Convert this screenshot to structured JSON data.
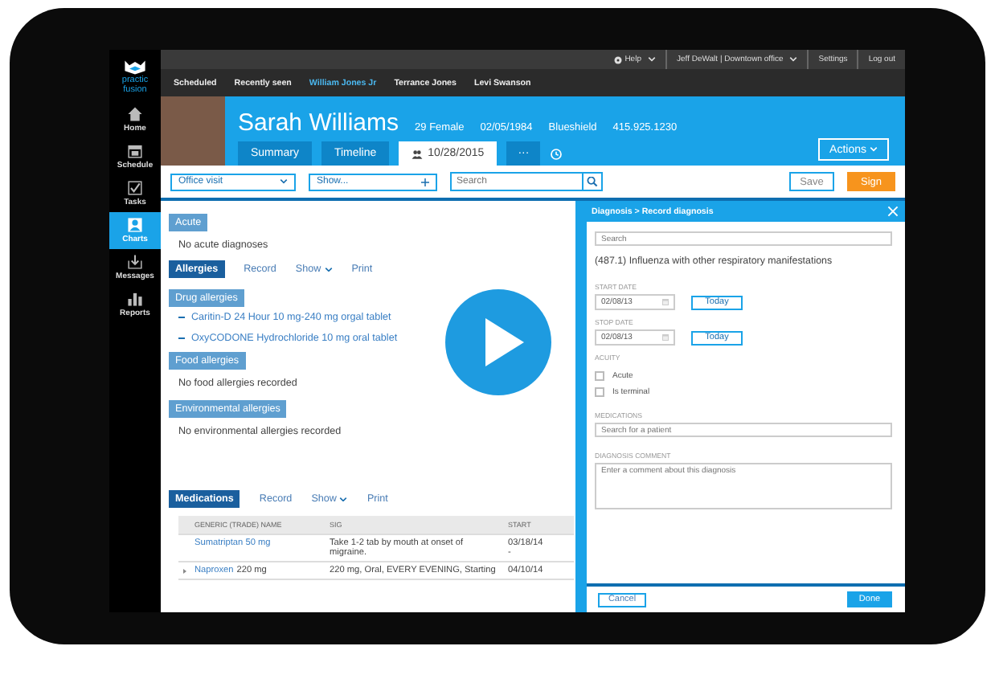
{
  "sidebar": {
    "logo": [
      "practic",
      "fusion"
    ],
    "items": [
      {
        "label": "Home",
        "selected": false
      },
      {
        "label": "Schedule",
        "selected": false
      },
      {
        "label": "Tasks",
        "selected": false
      },
      {
        "label": "Charts",
        "selected": true
      },
      {
        "label": "Messages",
        "selected": false
      },
      {
        "label": "Reports",
        "selected": false
      }
    ]
  },
  "top_bar": {
    "help": "Help",
    "user": "Jeff DeWalt | Downtown office",
    "links": [
      "Settings",
      "Log out"
    ]
  },
  "recent_bar": {
    "items": [
      {
        "label": "Scheduled",
        "selected": false
      },
      {
        "label": "Recently seen",
        "selected": false
      },
      {
        "label": "William Jones Jr",
        "selected": true
      },
      {
        "label": "Terrance Jones",
        "selected": false
      },
      {
        "label": "Levi Swanson",
        "selected": false
      }
    ]
  },
  "patient": {
    "name": "Sarah Williams",
    "details": [
      "29 Female",
      "02/05/1984",
      "Blueshield",
      "415.925.1230"
    ],
    "tabs": [
      {
        "label": "Summary",
        "kind": "text",
        "selected": false
      },
      {
        "label": "Timeline",
        "kind": "text",
        "selected": false
      },
      {
        "label": "10/28/2015",
        "kind": "encounter",
        "selected": true
      }
    ],
    "more": "···",
    "actions": "Actions"
  },
  "toolbar": {
    "visit_type": "Office visit",
    "show": "Show...",
    "search_placeholder": "Search",
    "save": "Save",
    "sign": "Sign"
  },
  "acute": {
    "heading": "Acute",
    "text": "No acute diagnoses"
  },
  "allergies": {
    "tab": "Allergies",
    "actions": [
      {
        "label": "Record",
        "dropdown": false
      },
      {
        "label": "Show",
        "dropdown": true
      },
      {
        "label": "Print",
        "dropdown": false
      }
    ],
    "groups": [
      {
        "heading": "Drug allergies",
        "items": [
          "Caritin-D 24 Hour 10 mg-240 mg orgal tablet",
          "OxyCODONE Hydrochloride 10 mg oral tablet"
        ]
      },
      {
        "heading": "Food allergies",
        "empty": "No food allergies recorded"
      },
      {
        "heading": "Environmental allergies",
        "empty": "No environmental allergies recorded"
      }
    ]
  },
  "medications": {
    "tab": "Medications",
    "actions": [
      {
        "label": "Record",
        "dropdown": false
      },
      {
        "label": "Show",
        "dropdown": true
      },
      {
        "label": "Print",
        "dropdown": false
      }
    ],
    "columns": [
      "GENERIC (TRADE) NAME",
      "SIG",
      "START"
    ],
    "rows": [
      {
        "name": "Sumatriptan 50 mg",
        "sig": "Take 1-2 tab by mouth at onset of migraine.",
        "start": "03/18/14",
        "start_note": "-",
        "expandable": false
      },
      {
        "name": "Naproxen",
        "dose": "220 mg",
        "sig": "220 mg, Oral, EVERY EVENING, Starting",
        "start": "04/10/14",
        "expandable": true
      }
    ]
  },
  "diagnosis_panel": {
    "breadcrumb": "Diagnosis > Record diagnosis",
    "search_placeholder": "Search",
    "diagnosis": "(487.1) Influenza with other respiratory manifestations",
    "dates": [
      {
        "label": "START DATE",
        "value": "02/08/13",
        "button": "Today"
      },
      {
        "label": "STOP DATE",
        "value": "02/08/13",
        "button": "Today"
      }
    ],
    "acuity": {
      "label": "ACUITY",
      "options": [
        {
          "label": "Acute",
          "checked": false
        },
        {
          "label": "Is terminal",
          "checked": false
        }
      ]
    },
    "medications": {
      "label": "MEDICATIONS",
      "placeholder": "Search for a patient"
    },
    "comment": {
      "label": "DIAGNOSIS COMMENT",
      "placeholder": "Enter a comment about this diagnosis"
    },
    "cancel": "Cancel",
    "done": "Done"
  }
}
